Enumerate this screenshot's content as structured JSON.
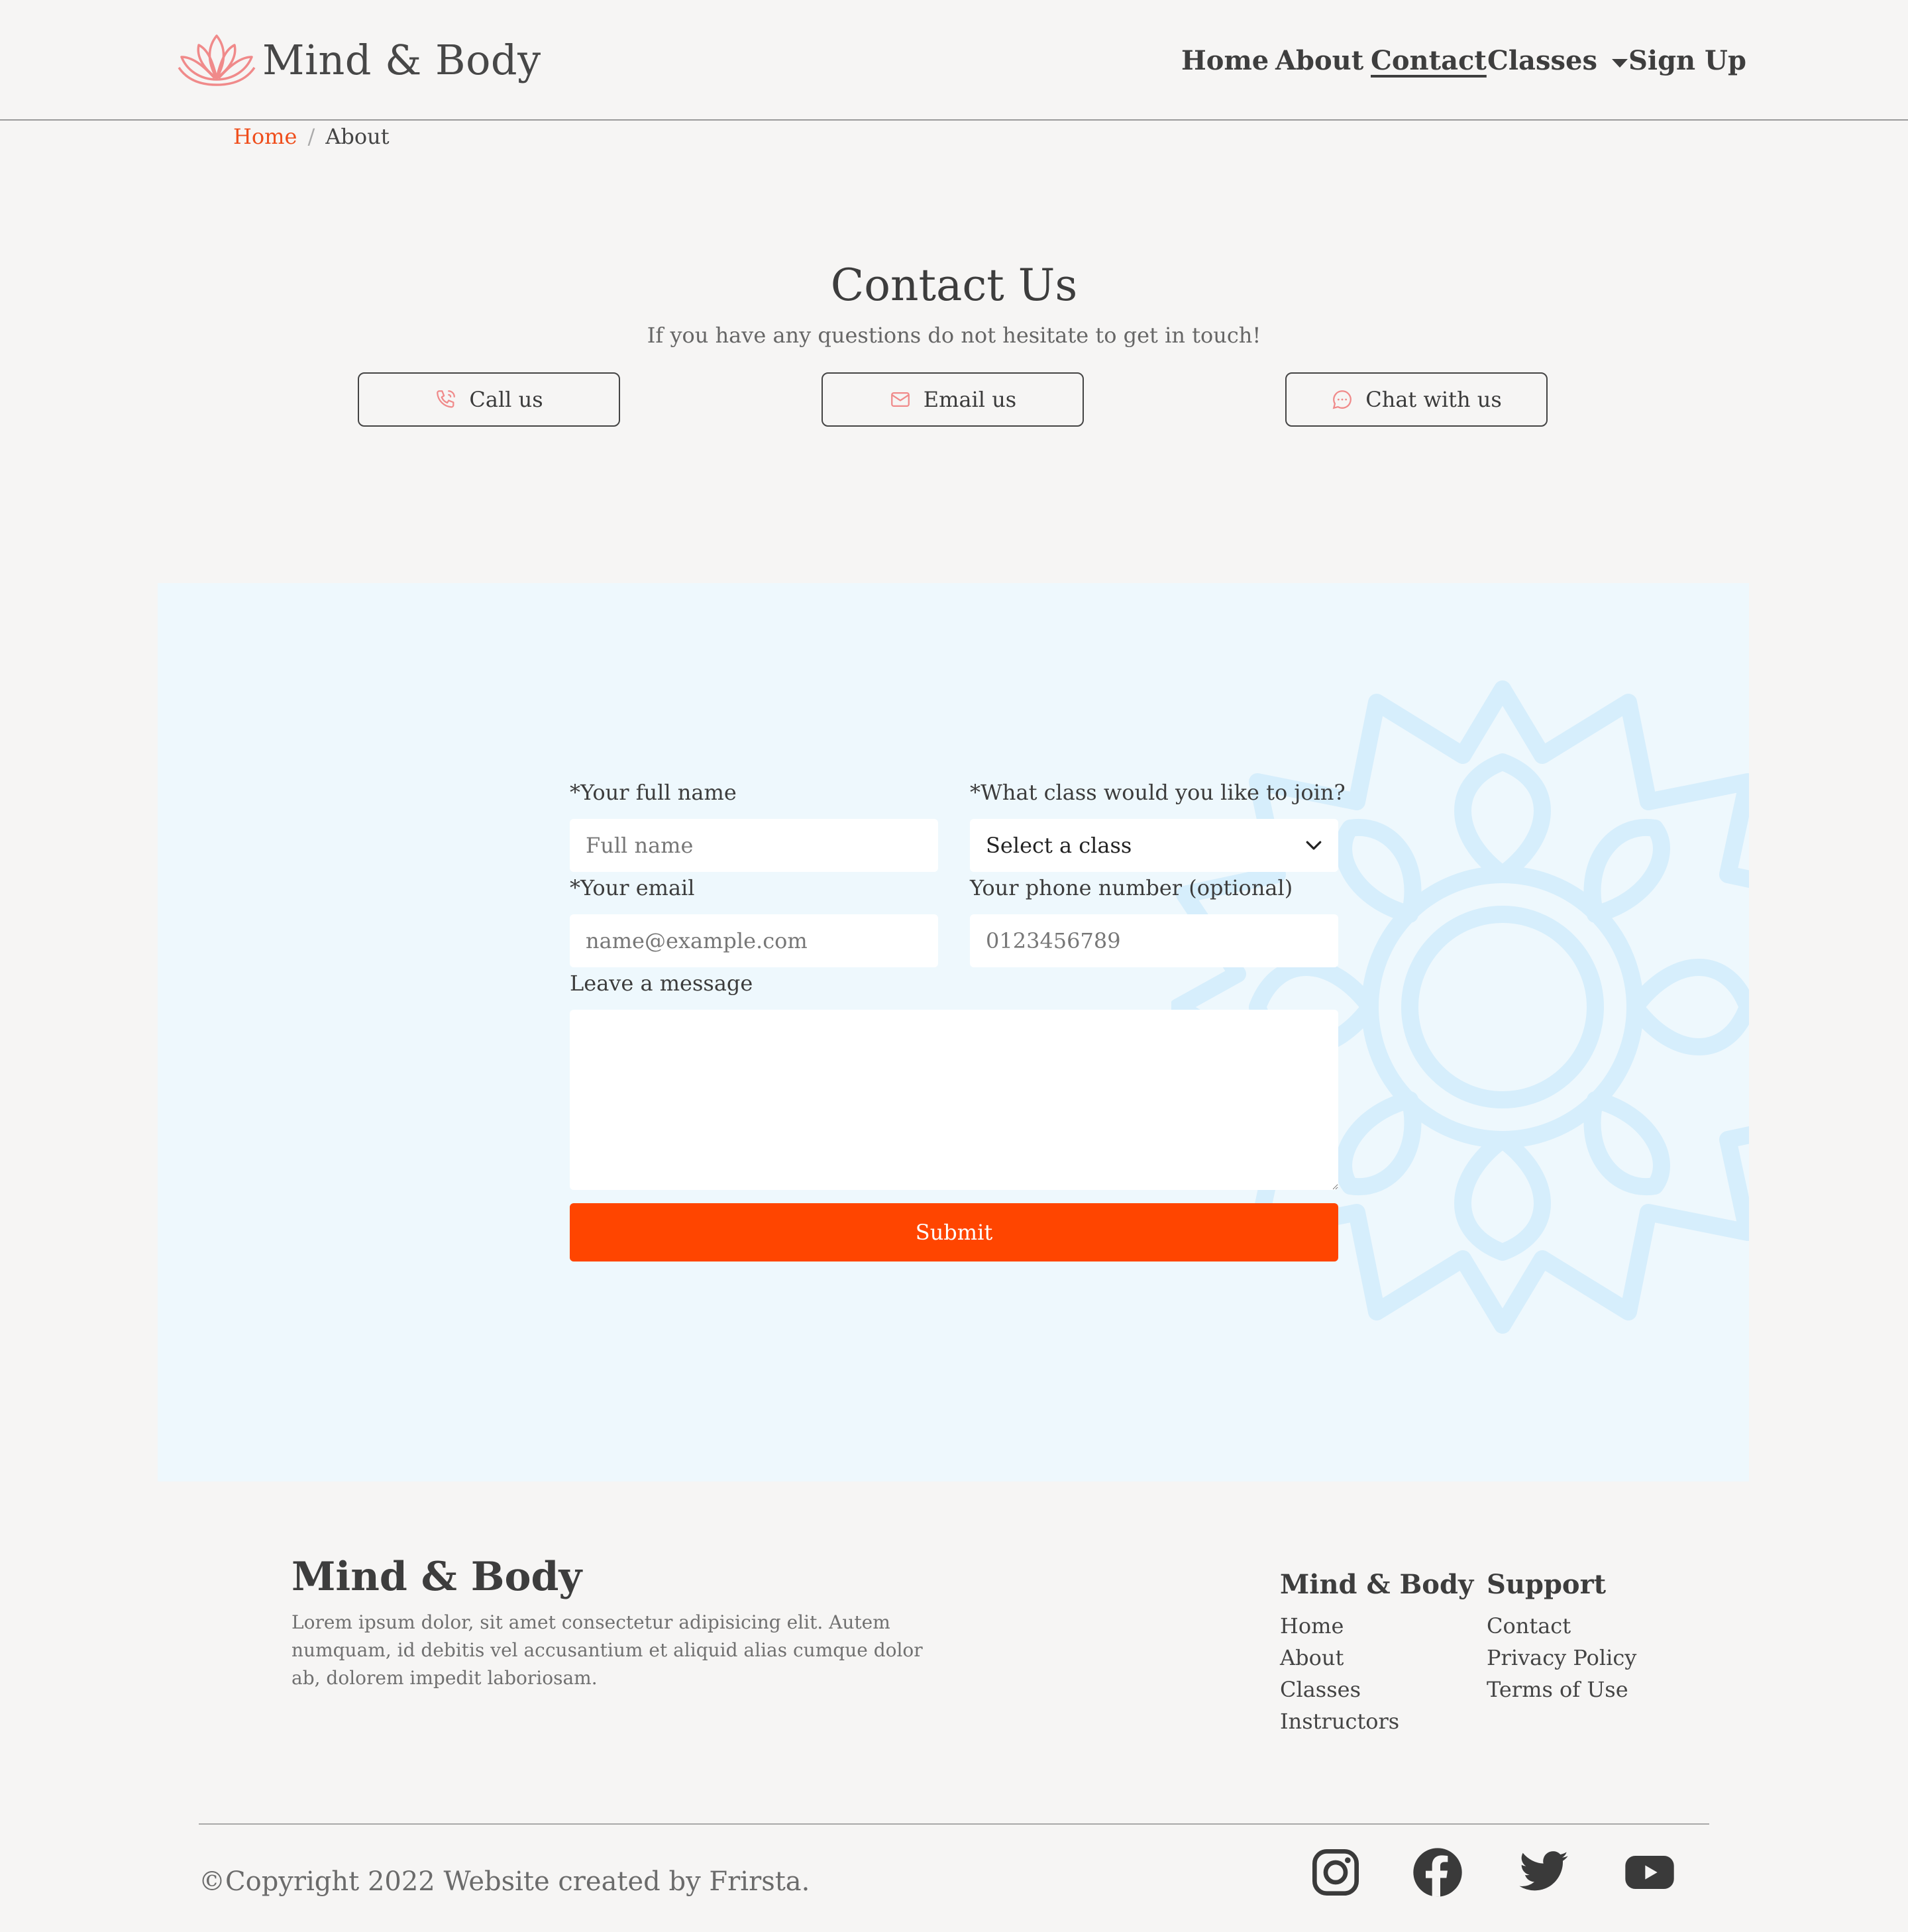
{
  "header": {
    "brand": "Mind & Body",
    "nav": {
      "home": "Home",
      "about": "About",
      "contact": "Contact",
      "classes": "Classes",
      "signup": "Sign Up"
    }
  },
  "breadcrumb": {
    "home": "Home",
    "separator": "/",
    "current": "About"
  },
  "contact": {
    "title": "Contact Us",
    "subtitle": "If you have any questions do not hesitate to get in touch!",
    "buttons": {
      "call": "Call us",
      "email": "Email us",
      "chat": "Chat with us"
    }
  },
  "form": {
    "name_label": "*Your full name",
    "name_placeholder": "Full name",
    "class_label": "*What class would you like to join?",
    "class_selected": "Select a class",
    "email_label": "*Your email",
    "email_placeholder": "name@example.com",
    "phone_label": "Your phone number (optional)",
    "phone_placeholder": "0123456789",
    "message_label": "Leave a message",
    "submit": "Submit"
  },
  "footer": {
    "brand": "Mind & Body",
    "description": "Lorem ipsum dolor, sit amet consectetur adipisicing elit. Autem numquam, id debitis vel accusantium et aliquid alias cumque dolor ab, dolorem impedit laboriosam.",
    "col1": {
      "title": "Mind & Body",
      "links": [
        "Home",
        "About",
        "Classes",
        "Instructors"
      ]
    },
    "col2": {
      "title": "Support",
      "links": [
        "Contact",
        "Privacy Policy",
        "Terms of Use"
      ]
    },
    "copyright": "©Copyright 2022 Website created by Frirsta."
  },
  "icons": {
    "logo": "lotus-logo-icon",
    "call": "phone-icon",
    "email": "envelope-icon",
    "chat": "chat-icon",
    "select": "chevron-down-icon",
    "social": [
      "instagram-icon",
      "facebook-icon",
      "twitter-icon",
      "youtube-icon"
    ]
  },
  "colors": {
    "accent": "#ff4500",
    "breadcrumb_link": "#ef4e1c",
    "icon_pink": "#f08a8a",
    "form_background": "#eef8fd",
    "mandala": "#d6eefc",
    "page_background": "#f6f5f4"
  }
}
